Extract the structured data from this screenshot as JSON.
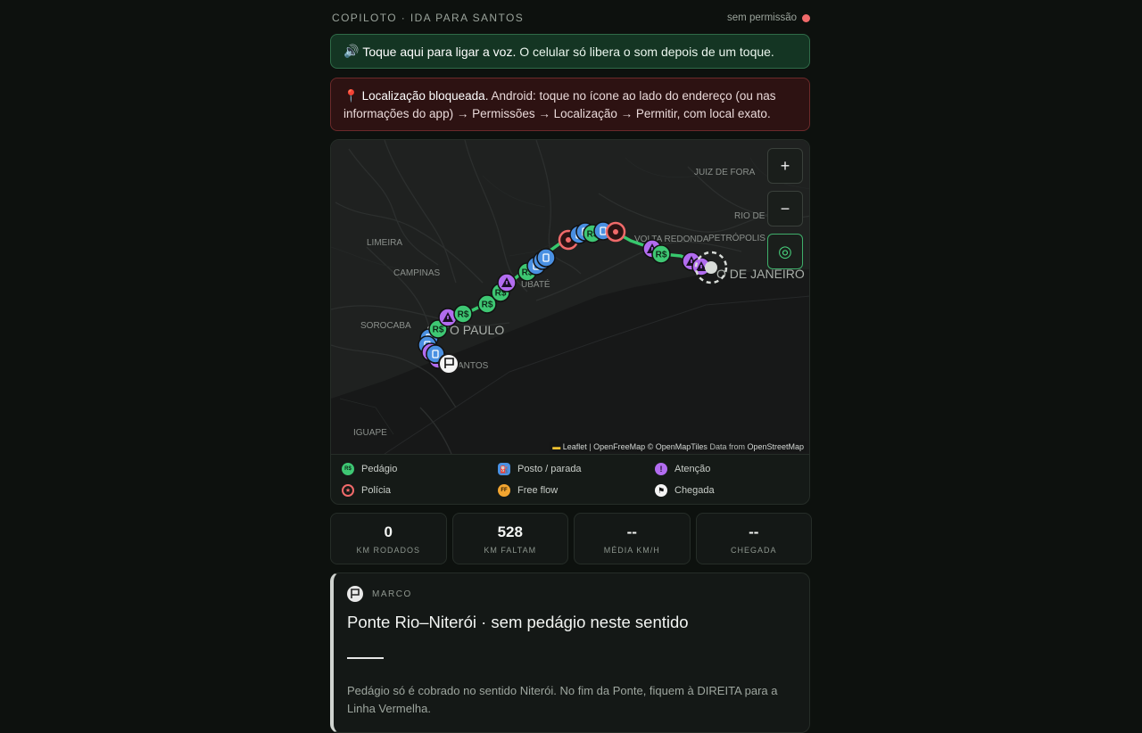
{
  "header": {
    "title": "COPILOTO · IDA PARA SANTOS",
    "permission": "sem permissão"
  },
  "voice_banner": {
    "icon": "🔊",
    "highlight": "Toque aqui para ligar a voz.",
    "text": "O celular só libera o som depois de um toque."
  },
  "location_banner": {
    "icon": "📍",
    "title": "Localização bloqueada.",
    "text": "Android: toque no ícone ao lado do endereço (ou nas informações do app) → Permissões → Localização → Permitir, com local exato."
  },
  "map": {
    "labels": {
      "juiz_de_fora": "JUIZ DE FORA",
      "rio": "RIO DE JA",
      "limeira": "LIMEIRA",
      "petropolis": "PETRÓPOLIS",
      "volta_redonda": "VOLTA REDONDA",
      "campinas": "CAMPINAS",
      "taubate": "UBATÉ",
      "rio_big": "O DE JANEIRO",
      "sorocaba": "SOROCABA",
      "sao_paulo_a": "S",
      "sao_paulo_b": "O PAULO",
      "santos": "ANTOS",
      "iguape": "IGUAPE"
    },
    "controls": {
      "zoom_in": "+",
      "zoom_out": "−",
      "locate": "◎"
    },
    "attribution": {
      "flag": "▬",
      "leaflet": "Leaflet",
      "sep": " | ",
      "omt": "OpenFreeMap © OpenMapTiles",
      "data_from": " Data from ",
      "osm": "OpenStreetMap"
    },
    "toll_label": "R$",
    "colors": {
      "route": "#37c86d",
      "toll": "#3ec773",
      "police": "#f06a6a",
      "fuel": "#4a90e2",
      "attention": "#b26cf0",
      "water": "#171818",
      "land": "#1f2120"
    }
  },
  "legend": [
    {
      "key": "toll",
      "label": "Pedágio",
      "glyph": "R$"
    },
    {
      "key": "fuel",
      "label": "Posto / parada",
      "glyph": "⛽"
    },
    {
      "key": "attention",
      "label": "Atenção",
      "glyph": "!"
    },
    {
      "key": "police",
      "label": "Polícia",
      "glyph": "★"
    },
    {
      "key": "freeflow",
      "label": "Free flow",
      "glyph": "FF"
    },
    {
      "key": "finish",
      "label": "Chegada",
      "glyph": "⚑"
    }
  ],
  "stats": [
    {
      "value": "0",
      "label": "KM RODADOS"
    },
    {
      "value": "528",
      "label": "KM FALTAM"
    },
    {
      "value": "--",
      "label": "MÉDIA KM/H"
    },
    {
      "value": "--",
      "label": "CHEGADA"
    }
  ],
  "marco": {
    "tag": "MARCO",
    "title": "Ponte Rio–Niterói · sem pedágio neste sentido",
    "text": "Pedágio só é cobrado no sentido Niterói. No fim da Ponte, fiquem à DIREITA para a Linha Vermelha."
  }
}
